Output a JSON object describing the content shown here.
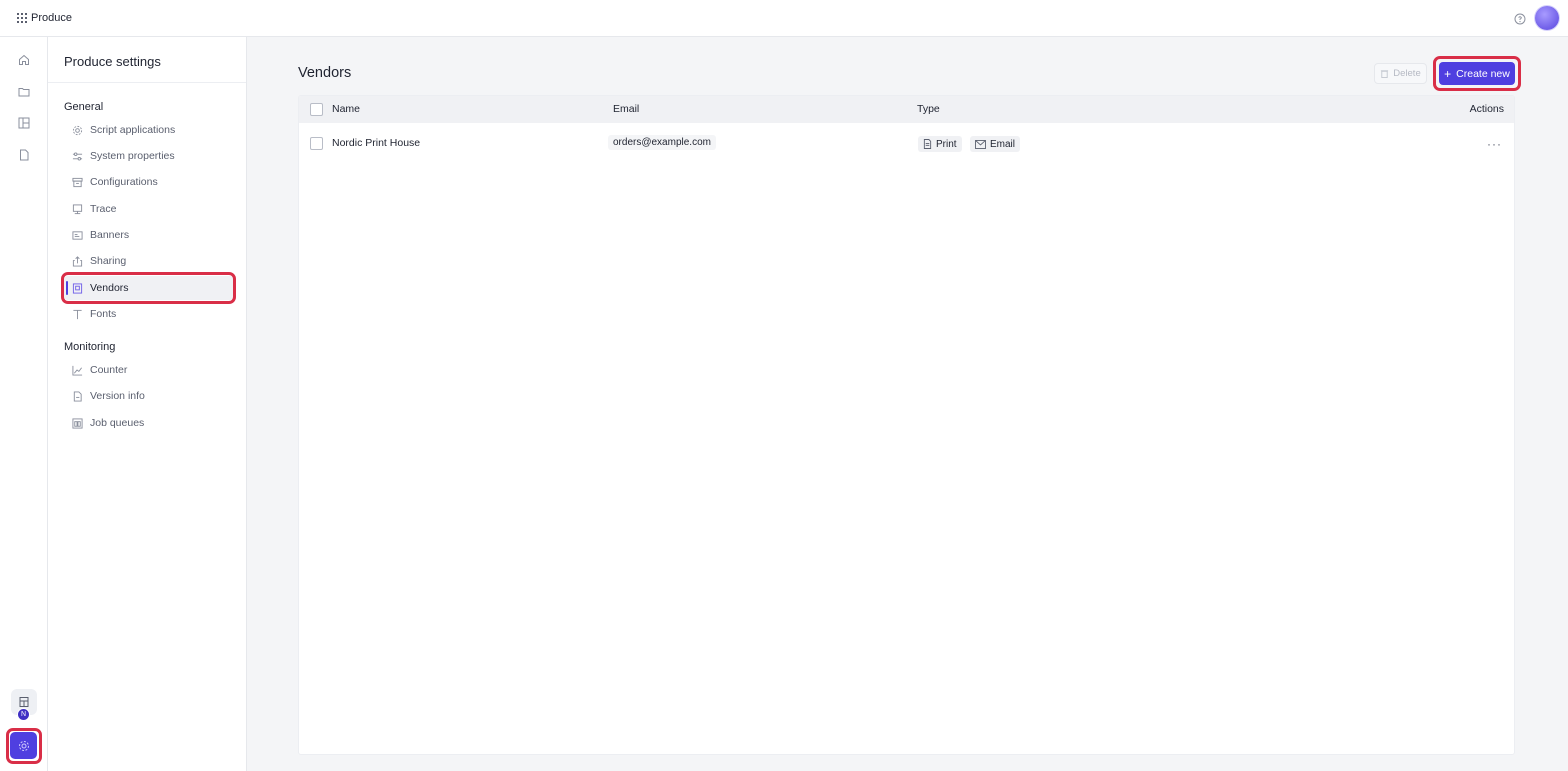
{
  "topbar": {
    "app_name": "Produce"
  },
  "rail": {
    "badge": "N"
  },
  "settings_nav": {
    "title": "Produce settings",
    "sections": [
      {
        "label": "General",
        "items": [
          {
            "label": "Script applications",
            "icon": "gear-icon"
          },
          {
            "label": "System properties",
            "icon": "sliders-icon"
          },
          {
            "label": "Configurations",
            "icon": "archive-icon"
          },
          {
            "label": "Trace",
            "icon": "monitor-icon"
          },
          {
            "label": "Banners",
            "icon": "banner-icon"
          },
          {
            "label": "Sharing",
            "icon": "share-icon"
          },
          {
            "label": "Vendors",
            "icon": "vendor-icon",
            "active": true
          },
          {
            "label": "Fonts",
            "icon": "font-icon"
          }
        ]
      },
      {
        "label": "Monitoring",
        "items": [
          {
            "label": "Counter",
            "icon": "chart-line-icon"
          },
          {
            "label": "Version info",
            "icon": "file-info-icon"
          },
          {
            "label": "Job queues",
            "icon": "queue-icon"
          }
        ]
      }
    ]
  },
  "main": {
    "title": "Vendors",
    "delete_label": "Delete",
    "create_label": "Create new",
    "accent": "#4f3fe0",
    "highlight": "#d92e47",
    "columns": [
      "Name",
      "Email",
      "Type",
      "Actions"
    ],
    "rows": [
      {
        "name": "Nordic Print House",
        "email": "orders@example.com",
        "types": [
          "Print",
          "Email"
        ]
      }
    ]
  }
}
